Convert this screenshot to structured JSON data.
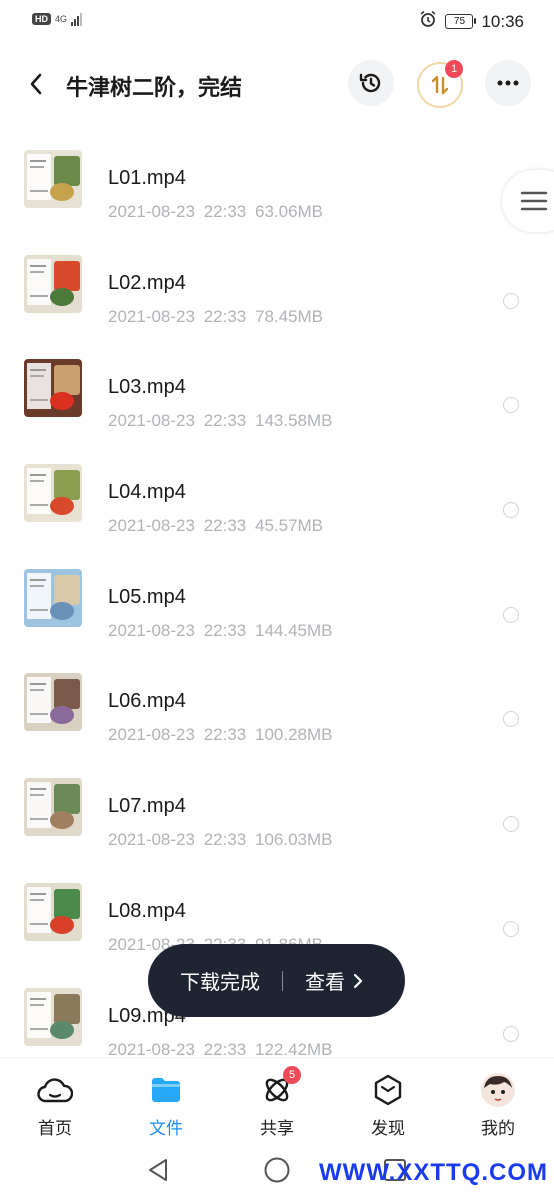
{
  "status_bar": {
    "hd": "HD",
    "network": "4G",
    "battery": "75",
    "time": "10:36"
  },
  "header": {
    "title": "牛津树二阶，完结",
    "transfer_badge": "1"
  },
  "files": [
    {
      "name": "L01.mp4",
      "date": "2021-08-23",
      "time": "22:33",
      "size": "63.06MB",
      "thumb_colors": [
        "#e6e2d6",
        "#6a8a4a",
        "#c7a24d"
      ]
    },
    {
      "name": "L02.mp4",
      "date": "2021-08-23",
      "time": "22:33",
      "size": "78.45MB",
      "thumb_colors": [
        "#e4ded0",
        "#d94a2a",
        "#4d7a3a"
      ]
    },
    {
      "name": "L03.mp4",
      "date": "2021-08-23",
      "time": "22:33",
      "size": "143.58MB",
      "thumb_colors": [
        "#6a3a2a",
        "#c9a070",
        "#d93020"
      ]
    },
    {
      "name": "L04.mp4",
      "date": "2021-08-23",
      "time": "22:33",
      "size": "45.57MB",
      "thumb_colors": [
        "#e8e2d2",
        "#8aa050",
        "#d84a2a"
      ]
    },
    {
      "name": "L05.mp4",
      "date": "2021-08-23",
      "time": "22:33",
      "size": "144.45MB",
      "thumb_colors": [
        "#9cc4e0",
        "#d8c8a8",
        "#6a90b8"
      ]
    },
    {
      "name": "L06.mp4",
      "date": "2021-08-23",
      "time": "22:33",
      "size": "100.28MB",
      "thumb_colors": [
        "#d8d0c0",
        "#7a5a4a",
        "#8a6a9a"
      ]
    },
    {
      "name": "L07.mp4",
      "date": "2021-08-23",
      "time": "22:33",
      "size": "106.03MB",
      "thumb_colors": [
        "#e0d8c8",
        "#6a8a5a",
        "#a08060"
      ]
    },
    {
      "name": "L08.mp4",
      "date": "2021-08-23",
      "time": "22:33",
      "size": "91.86MB",
      "thumb_colors": [
        "#e2dccc",
        "#4a8a4a",
        "#d8402a"
      ]
    },
    {
      "name": "L09.mp4",
      "date": "2021-08-23",
      "time": "22:33",
      "size": "122.42MB",
      "thumb_colors": [
        "#e6e0d2",
        "#8a7a5a",
        "#5a8a6a"
      ]
    }
  ],
  "toast": {
    "message": "下载完成",
    "action": "查看"
  },
  "tabs": [
    {
      "label": "首页",
      "icon": "cloud-home-icon"
    },
    {
      "label": "文件",
      "icon": "folder-icon",
      "active": true
    },
    {
      "label": "共享",
      "icon": "atom-share-icon",
      "badge": "5"
    },
    {
      "label": "发现",
      "icon": "discover-hexagon-icon"
    },
    {
      "label": "我的",
      "icon": "avatar"
    }
  ],
  "watermark": "WWW.XXTTQ.COM",
  "colors": {
    "accent": "#1e8cf3",
    "badge_red": "#f04a5a",
    "toast_bg": "#1e2432",
    "meta_gray": "#b0b3b8"
  }
}
